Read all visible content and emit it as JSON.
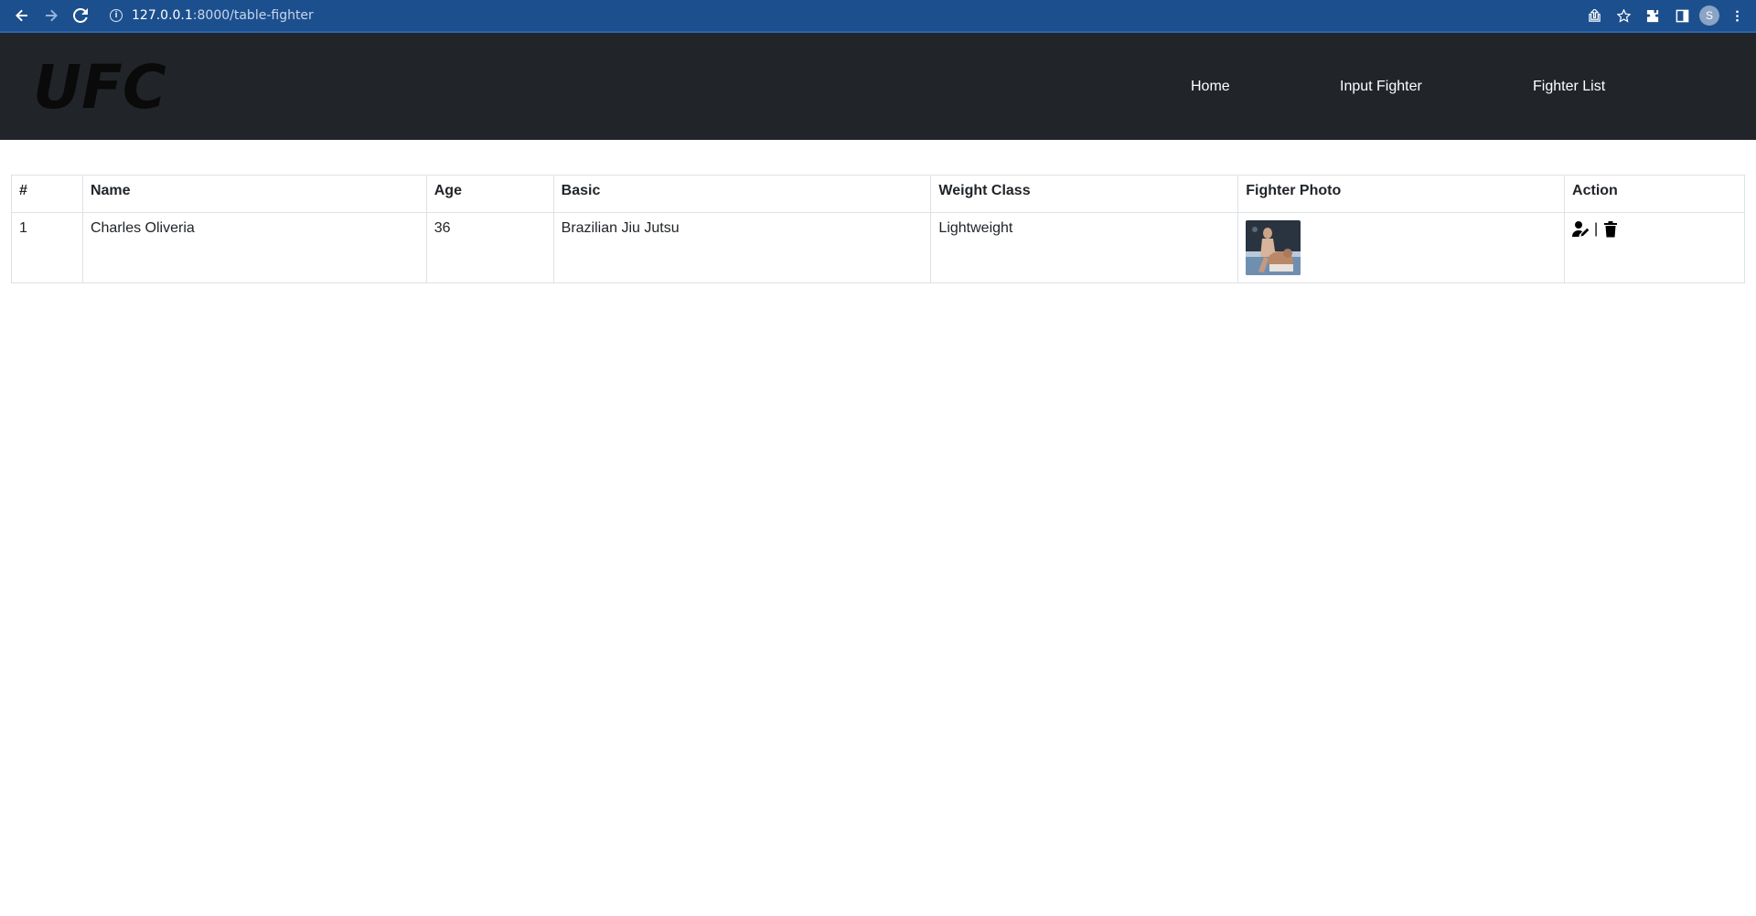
{
  "browser": {
    "url_host": "127.0.0.1",
    "url_path": ":8000/table-fighter",
    "profile_initial": "S"
  },
  "navbar": {
    "logo_text": "UFC",
    "links": [
      {
        "label": "Home"
      },
      {
        "label": "Input Fighter"
      },
      {
        "label": "Fighter List"
      }
    ]
  },
  "table": {
    "headers": [
      "#",
      "Name",
      "Age",
      "Basic",
      "Weight Class",
      "Fighter Photo",
      "Action"
    ],
    "rows": [
      {
        "index": "1",
        "name": "Charles Oliveria",
        "age": "36",
        "basic": "Brazilian Jiu Jutsu",
        "weight_class": "Lightweight",
        "photo_icon": "fighter-photo",
        "action_separator": "|"
      }
    ]
  },
  "colors": {
    "chrome": "#1c4f8e",
    "navbar": "#212529",
    "border": "#dee2e6"
  }
}
